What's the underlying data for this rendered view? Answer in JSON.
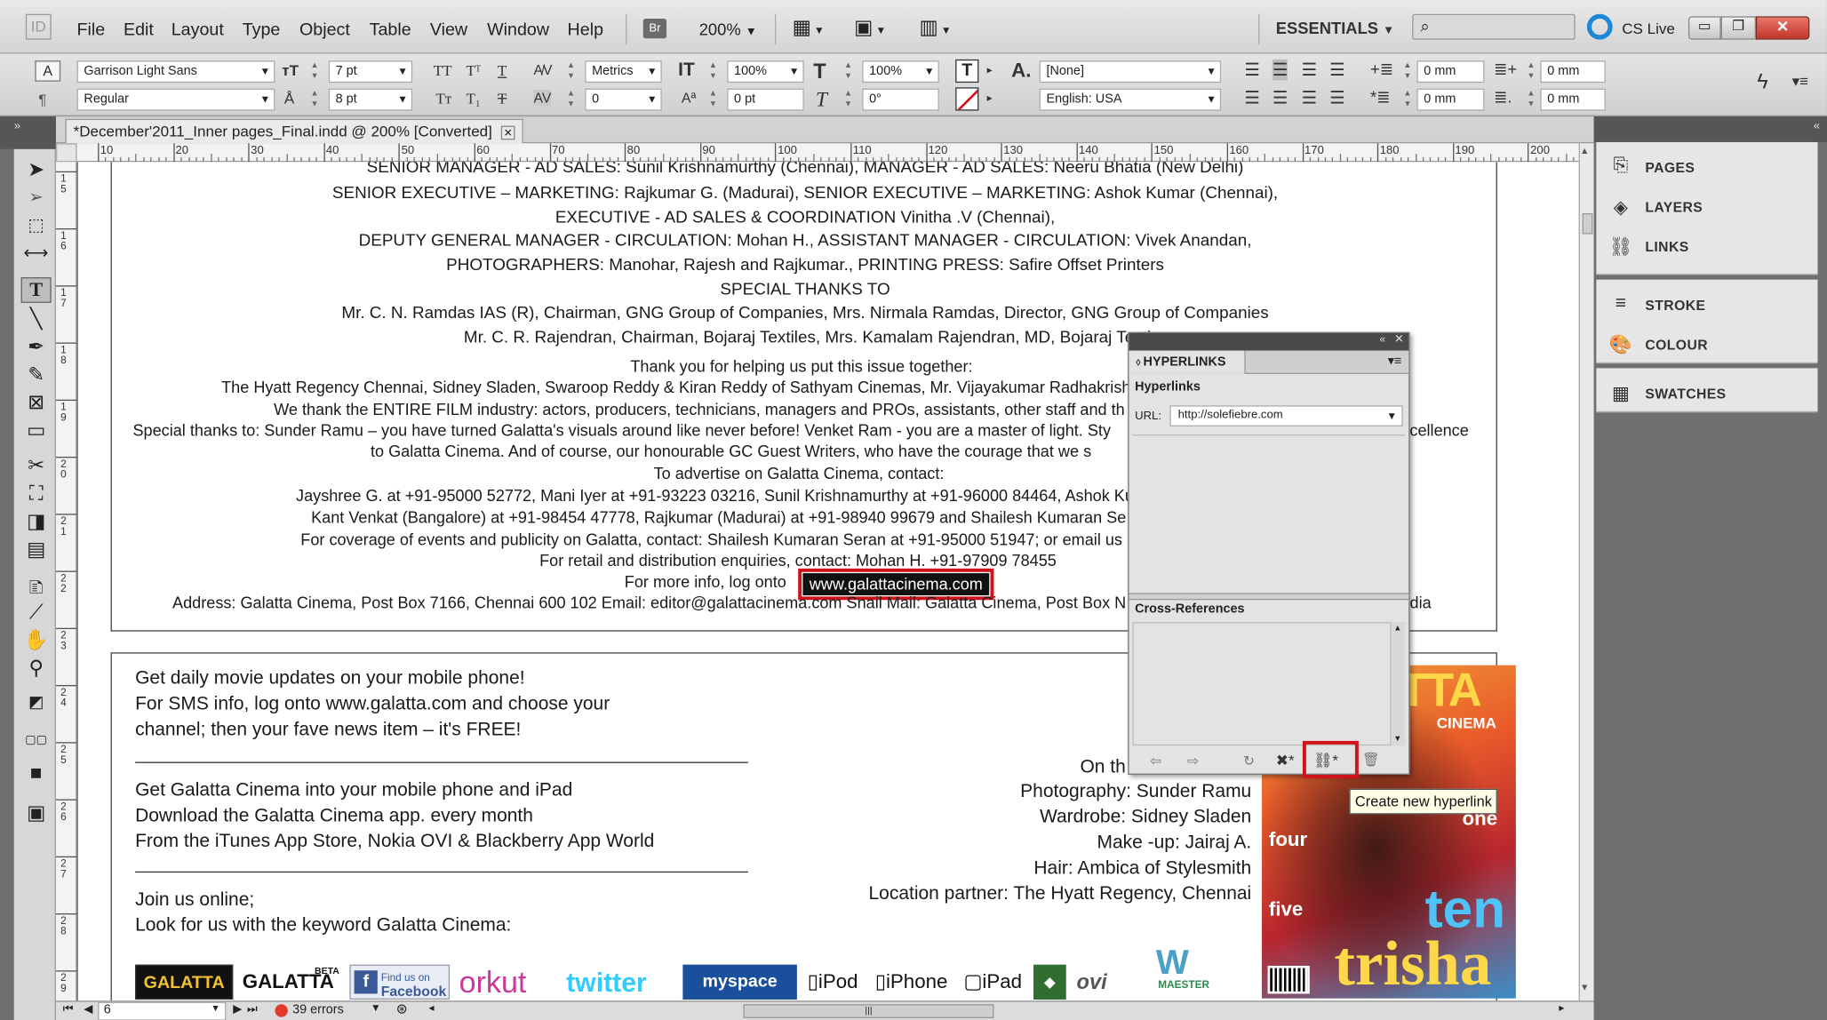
{
  "menubar": {
    "app_badge": "ID",
    "items": [
      "File",
      "Edit",
      "Layout",
      "Type",
      "Object",
      "Table",
      "View",
      "Window",
      "Help"
    ],
    "bridge": "Br",
    "zoom": "200%",
    "workspace": "ESSENTIALS",
    "cs_live": "CS Live"
  },
  "control": {
    "font_family": "Garrison Light Sans",
    "font_style": "Regular",
    "font_size": "7 pt",
    "leading": "8 pt",
    "kerning": "Metrics",
    "tracking": "0",
    "vscale": "100%",
    "hscale": "100%",
    "baseline": "0 pt",
    "skew": "0°",
    "char_style": "[None]",
    "language": "English: USA",
    "indent_left": "0 mm",
    "indent_first": "0 mm",
    "indent_right": "0 mm",
    "indent_last": "0 mm"
  },
  "document": {
    "tab_title": "*December'2011_Inner pages_Final.indd @ 200% [Converted]",
    "ruler_ticks": [
      "10",
      "20",
      "30",
      "40",
      "50",
      "60",
      "70",
      "80",
      "90",
      "100",
      "110",
      "120",
      "130",
      "140",
      "150",
      "160",
      "170",
      "180",
      "190",
      "200"
    ],
    "vruler_ticks": [
      "1\n5",
      "1\n6",
      "1\n7",
      "1\n8",
      "1\n9",
      "2\n0",
      "2\n1",
      "2\n2",
      "2\n3",
      "2\n4",
      "2\n5",
      "2\n6",
      "2\n7",
      "2\n8",
      "2\n9"
    ],
    "credits": [
      "SENIOR MANAGER - AD SALES: Sunil Krishnamurthy (Chennai), MANAGER - AD SALES: Neeru Bhatia (New Delhi)",
      "SENIOR EXECUTIVE – MARKETING: Rajkumar G. (Madurai), SENIOR EXECUTIVE – MARKETING: Ashok Kumar (Chennai),",
      "EXECUTIVE - AD SALES & COORDINATION Vinitha .V (Chennai),",
      "DEPUTY GENERAL MANAGER - CIRCULATION: Mohan H., ASSISTANT MANAGER - CIRCULATION: Vivek Anandan,",
      "PHOTOGRAPHERS: Manohar, Rajesh and Rajkumar., PRINTING PRESS: Safire Offset Printers",
      "SPECIAL THANKS TO",
      "Mr. C. N. Ramdas IAS (R), Chairman, GNG Group of Companies, Mrs. Nirmala Ramdas, Director, GNG Group of Companies",
      "Mr. C. R. Rajendran, Chairman, Bojaraj Textiles, Mrs. Kamalam Rajendran, MD, Bojaraj Texti"
    ],
    "thanks": [
      "Thank you for helping us put this issue together:",
      "The Hyatt Regency Chennai, Sidney Sladen, Swaroop Reddy & Kiran Reddy of Sathyam Cinemas, Mr. Vijayakumar Radhakrish",
      "We thank the ENTIRE FILM industry: actors, producers, technicians, managers and PROs, assistants, other staff and th",
      "Special thanks to: Sunder Ramu – you have turned Galatta's visuals around like never before! Venket Ram - you are a master of light. Sty",
      "to Galatta Cinema. And of course, our honourable GC Guest Writers, who have the courage that we s",
      "To advertise on Galatta Cinema, contact:",
      "Jayshree G. at +91-95000 52772, Mani Iyer at +91-93223 03216, Sunil Krishnamurthy at +91-96000 84464, Ashok Ku",
      "Kant Venkat (Bangalore) at +91-98454 47778, Rajkumar (Madurai) at +91-98940 99679 and Shailesh Kumaran Se",
      "For coverage of events and publicity on Galatta, contact: Shailesh Kumaran Seran at +91-95000 51947; or email us",
      "For retail and distribution enquiries, contact: Mohan H. +91-97909 78455"
    ],
    "excellence": "xcellence",
    "more_info": "For more info, log onto",
    "link_text": "www.galattacinema.com",
    "address": "Address: Galatta Cinema, Post Box 7166, Chennai 600 102 Email: editor@galattacinema.com Snail Mail: Galatta Cinema, Post Box N",
    "address_tail": "dia",
    "bottom_left": [
      "Get daily movie updates on your mobile phone!",
      "For SMS info, log onto www.galatta.com and choose your",
      "channel; then your fave news item – it's FREE!",
      "Get Galatta Cinema into your mobile phone and iPad",
      "Download the Galatta Cinema app. every month",
      "From the iTunes App Store, Nokia OVI & Blackberry App World",
      "Join us online;",
      "Look for us with the keyword Galatta Cinema:"
    ],
    "on_the": "On th",
    "cover_credits": [
      "Photography: Sunder Ramu",
      "Wardrobe: Sidney Sladen",
      "Make -up: Jairaj A.",
      "Hair: Ambica of Stylesmith",
      "Location partner: The Hyatt Regency, Chennai"
    ],
    "logos": {
      "galatta1": "GALATTA",
      "galatta2": "GALATTA",
      "beta": "BETA",
      "fb_find": "Find us on",
      "fb": "Facebook",
      "orkut": "orkut",
      "twitter": "twitter",
      "myspace": "myspace",
      "ipod": "iPod",
      "iphone": "iPhone",
      "ipad": "iPad",
      "ovi": "ovi",
      "mw": "MAESTER"
    },
    "magazine": {
      "brand_top": "TTA",
      "brand_sub": "CINEMA",
      "one": "one",
      "four": "four",
      "five": "five",
      "ten": "ten",
      "trisha": "trisha"
    }
  },
  "status": {
    "page": "6",
    "errors": "39 errors"
  },
  "panels": {
    "items": [
      "PAGES",
      "LAYERS",
      "LINKS",
      "STROKE",
      "COLOUR",
      "SWATCHES"
    ]
  },
  "hyperlinks": {
    "tab": "HYPERLINKS",
    "section": "Hyperlinks",
    "url_label": "URL:",
    "url_value": "http://solefiebre.com",
    "cross_refs": "Cross-References",
    "tooltip": "Create new hyperlink"
  }
}
